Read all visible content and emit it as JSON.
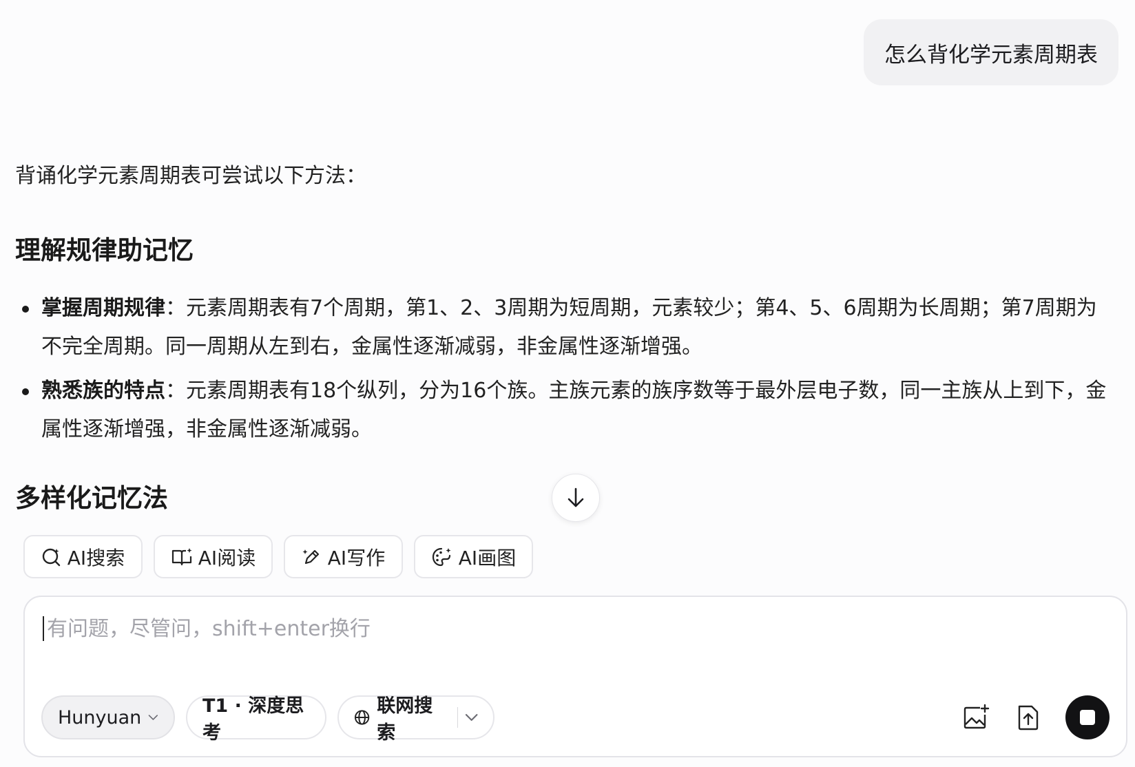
{
  "user_message": "怎么背化学元素周期表",
  "answer": {
    "intro": "背诵化学元素周期表可尝试以下方法：",
    "section1": {
      "title": "理解规律助记忆",
      "bullets": [
        {
          "bold": "掌握周期规律",
          "text": "：元素周期表有7个周期，第1、2、3周期为短周期，元素较少；第4、5、6周期为长周期；第7周期为不完全周期。同一周期从左到右，金属性逐渐减弱，非金属性逐渐增强。"
        },
        {
          "bold": "熟悉族的特点",
          "text": "：元素周期表有18个纵列，分为16个族。主族元素的族序数等于最外层电子数，同一主族从上到下，金属性逐渐增强，非金属性逐渐减弱。"
        }
      ]
    },
    "section2": {
      "title": "多样化记忆法"
    }
  },
  "tools": [
    {
      "label": "AI搜索",
      "icon": "ai-search-icon"
    },
    {
      "label": "AI阅读",
      "icon": "ai-read-icon"
    },
    {
      "label": "AI写作",
      "icon": "ai-write-icon"
    },
    {
      "label": "AI画图",
      "icon": "ai-draw-icon"
    }
  ],
  "composer": {
    "placeholder": "有问题，尽管问，shift+enter换行",
    "value": "",
    "model": "Hunyuan",
    "think_mode": "T1 · 深度思考",
    "web_search": "联网搜索"
  },
  "colors": {
    "background": "#fcfcfd",
    "bubble": "#f1f1f3",
    "stop_button": "#121214"
  }
}
